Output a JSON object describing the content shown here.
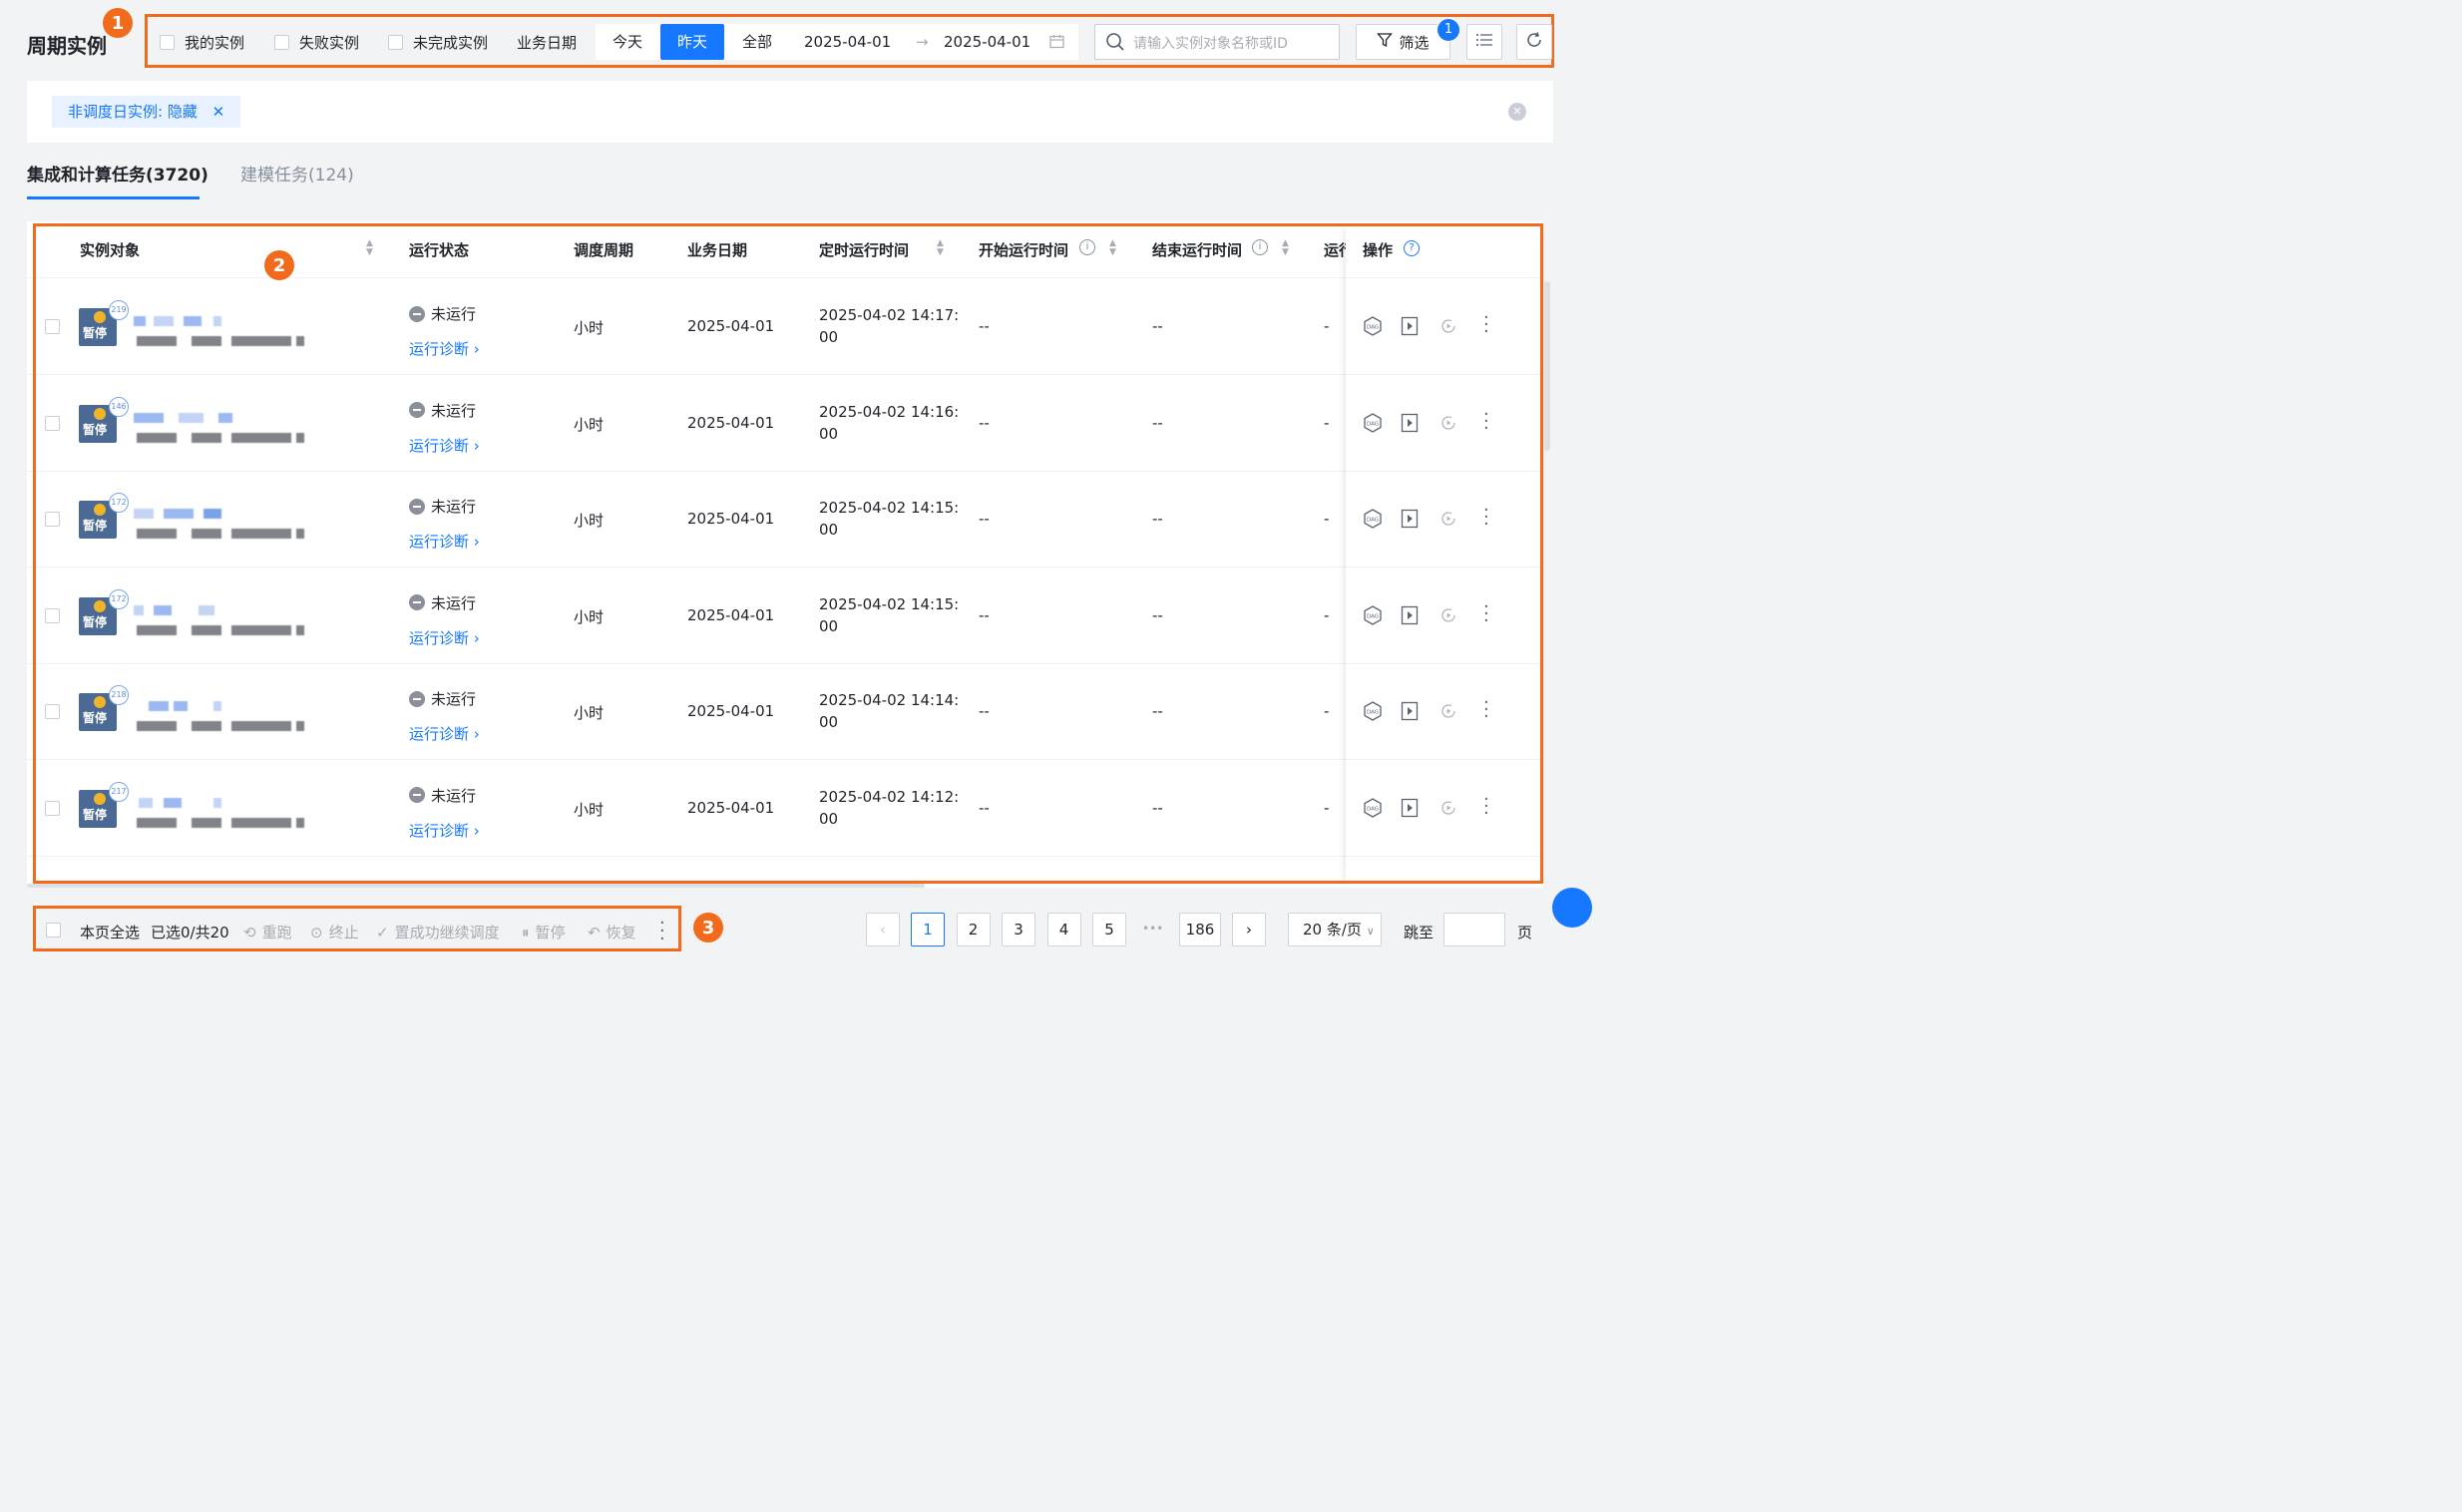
{
  "page": {
    "title": "周期实例"
  },
  "filters": {
    "my_instances": "我的实例",
    "failed_instances": "失败实例",
    "incomplete_instances": "未完成实例",
    "business_date_label": "业务日期",
    "today": "今天",
    "yesterday": "昨天",
    "all": "全部",
    "date_start": "2025-04-01",
    "date_end": "2025-04-01",
    "date_separator": "→",
    "search_placeholder": "请输入实例对象名称或ID",
    "filter_button": "筛选",
    "filter_count": "1"
  },
  "active_tag": {
    "label": "非调度日实例: 隐藏"
  },
  "tabs": [
    {
      "label": "集成和计算任务(3720)"
    },
    {
      "label": "建模任务(124)"
    }
  ],
  "table": {
    "headers": {
      "instance_object": "实例对象",
      "run_status": "运行状态",
      "schedule_cycle": "调度周期",
      "business_date": "业务日期",
      "scheduled_time": "定时运行时间",
      "start_time": "开始运行时间",
      "end_time": "结束运行时间",
      "run_more": "运行",
      "operations": "操作"
    },
    "rows": [
      {
        "badge": "219",
        "icon_label": "暂停",
        "status": "未运行",
        "diagnose": "运行诊断 ›",
        "cycle": "小时",
        "biz_date": "2025-04-01",
        "sched_1": "2025-04-02 14:17:",
        "sched_2": "00",
        "start": "--",
        "end": "--",
        "extra": "-"
      },
      {
        "badge": "146",
        "icon_label": "暂停",
        "status": "未运行",
        "diagnose": "运行诊断 ›",
        "cycle": "小时",
        "biz_date": "2025-04-01",
        "sched_1": "2025-04-02 14:16:",
        "sched_2": "00",
        "start": "--",
        "end": "--",
        "extra": "-"
      },
      {
        "badge": "172",
        "icon_label": "暂停",
        "status": "未运行",
        "diagnose": "运行诊断 ›",
        "cycle": "小时",
        "biz_date": "2025-04-01",
        "sched_1": "2025-04-02 14:15:",
        "sched_2": "00",
        "start": "--",
        "end": "--",
        "extra": "-"
      },
      {
        "badge": "172",
        "icon_label": "暂停",
        "status": "未运行",
        "diagnose": "运行诊断 ›",
        "cycle": "小时",
        "biz_date": "2025-04-01",
        "sched_1": "2025-04-02 14:15:",
        "sched_2": "00",
        "start": "--",
        "end": "--",
        "extra": "-"
      },
      {
        "badge": "218",
        "icon_label": "暂停",
        "status": "未运行",
        "diagnose": "运行诊断 ›",
        "cycle": "小时",
        "biz_date": "2025-04-01",
        "sched_1": "2025-04-02 14:14:",
        "sched_2": "00",
        "start": "--",
        "end": "--",
        "extra": "-"
      },
      {
        "badge": "217",
        "icon_label": "暂停",
        "status": "未运行",
        "diagnose": "运行诊断 ›",
        "cycle": "小时",
        "biz_date": "2025-04-01",
        "sched_1": "2025-04-02 14:12:",
        "sched_2": "00",
        "start": "--",
        "end": "--",
        "extra": "-"
      }
    ]
  },
  "footer": {
    "select_page": "本页全选",
    "selected_count": "已选0/共20",
    "rerun": "重跑",
    "stop": "终止",
    "set_success": "置成功继续调度",
    "pause": "暂停",
    "resume": "恢复",
    "pages": [
      "1",
      "2",
      "3",
      "4",
      "5"
    ],
    "ellipsis": "•••",
    "last_page": "186",
    "page_size": "20 条/页",
    "jump_to": "跳至",
    "page_unit": "页"
  },
  "annotations": {
    "n1": "1",
    "n2": "2",
    "n3": "3"
  },
  "colors": {
    "accent": "#1677ff",
    "annotation": "#f26a1b",
    "icon_bg": "#4a6a95"
  }
}
